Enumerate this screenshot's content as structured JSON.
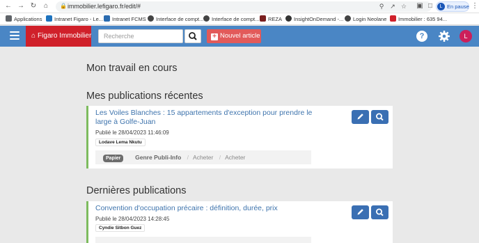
{
  "browser": {
    "url": "immobilier.lefigaro.fr/edit/#",
    "profile_initial": "L",
    "profile_label": "En pause"
  },
  "bookmarks": [
    {
      "label": "Applications",
      "color": "#5f6368"
    },
    {
      "label": "Intranet Figaro - Le...",
      "color": "#1e73be"
    },
    {
      "label": "Intranet FCMS",
      "color": "#2b6cb0"
    },
    {
      "label": "Interface de compt...",
      "color": "#444444"
    },
    {
      "label": "Interface de compt...",
      "color": "#444444"
    },
    {
      "label": "REZA",
      "color": "#7a1f1f"
    },
    {
      "label": "InsightOnDemand -...",
      "color": "#333333"
    },
    {
      "label": "Login Neolane",
      "color": "#444444"
    },
    {
      "label": "Immobilier : 635 94...",
      "color": "#d0202a"
    }
  ],
  "header": {
    "brand_label": "Figaro Immobilier",
    "search_placeholder": "Recherche",
    "new_article_label": "Nouvel article",
    "user_initial": "L",
    "accent": "#4a86c5",
    "brand_color": "#d0202a"
  },
  "main": {
    "work_heading": "Mon travail en cours",
    "recent_heading": "Mes publications récentes",
    "latest_heading": "Dernières publications",
    "recent": [
      {
        "title": "Les Voiles Blanches : 15 appartements d'exception pour prendre le large à Golfe-Juan",
        "date_prefix": "Publié le",
        "date": "28/04/2023 11:46:09",
        "author": "Lodave Lema Nkutu",
        "tags": {
          "pill": "Papier",
          "genre": "Genre Publi-Info",
          "t1": "Acheter",
          "t2": "Acheter"
        }
      }
    ],
    "latest": [
      {
        "title": "Convention d'occupation précaire : définition, durée, prix",
        "date_prefix": "Publié le",
        "date": "28/04/2023 14:28:45",
        "author": "Cyndie Sitbon Guez"
      }
    ]
  }
}
